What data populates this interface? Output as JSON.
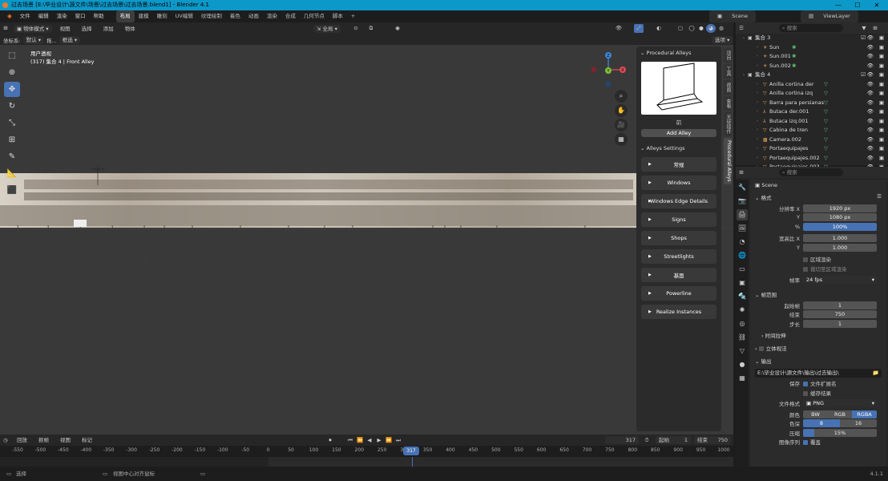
{
  "window": {
    "title": "过去场景 [E:\\毕业设计\\源文件\\场景\\过去场景\\过去场景.blend1] - Blender 4.1",
    "minimize": "—",
    "maximize": "☐",
    "close": "✕"
  },
  "menu": {
    "items": [
      "文件",
      "编辑",
      "渲染",
      "窗口",
      "帮助"
    ],
    "workspaces": [
      "布局",
      "建模",
      "雕刻",
      "UV编辑",
      "纹理绘制",
      "着色",
      "动画",
      "渲染",
      "合成",
      "几何节点",
      "脚本"
    ],
    "active_workspace": "布局",
    "add_tab": "+",
    "scene": "Scene",
    "view_layer": "ViewLayer"
  },
  "viewport_header": {
    "mode": "物体模式",
    "menus": [
      "视图",
      "选择",
      "添加",
      "物体"
    ],
    "transform_orientation": "全局",
    "options": "选项"
  },
  "viewport_header2": {
    "coord_label": "坐标系:",
    "coord_value": "默认",
    "drag_label": "拖...",
    "drag_value": "框选"
  },
  "viewport": {
    "view_name": "用户透视",
    "object_info": "(317) 集合 4 | Front Alley",
    "gizmo_axes": {
      "x": "X",
      "y": "Y",
      "z": "Z"
    },
    "accent_x": "#e04a55",
    "accent_y": "#7fbf3a",
    "accent_z": "#3f86d8"
  },
  "npanel": {
    "header": "Procedural Alleys",
    "thumb_label": "前",
    "add_button": "Add Alley",
    "settings_header": "Alleys Settings",
    "buttons": [
      "常规",
      "Windows",
      "Windows Edge Details",
      "Signs",
      "Shops",
      "Streetlights",
      "基面",
      "Powerline",
      "Realize Instances"
    ],
    "tabs": [
      "项目",
      "工具",
      "视图",
      "查看",
      "天使插件",
      "Procedural Alleys"
    ]
  },
  "outliner": {
    "search_placeholder": "搜索",
    "rows": [
      {
        "name": "集合 3",
        "indent": 1,
        "icon": "collection"
      },
      {
        "name": "Sun",
        "indent": 2,
        "icon": "light"
      },
      {
        "name": "Sun.001",
        "indent": 2,
        "icon": "light"
      },
      {
        "name": "Sun.002",
        "indent": 2,
        "icon": "light"
      },
      {
        "name": "集合 4",
        "indent": 1,
        "icon": "collection"
      },
      {
        "name": "Anilla cortina der",
        "indent": 2,
        "icon": "mesh"
      },
      {
        "name": "Anilla cortina izq",
        "indent": 2,
        "icon": "mesh"
      },
      {
        "name": "Barra para persianas",
        "indent": 2,
        "icon": "mesh"
      },
      {
        "name": "Butaca der.001",
        "indent": 2,
        "icon": "armature"
      },
      {
        "name": "Butaca izq.001",
        "indent": 2,
        "icon": "armature"
      },
      {
        "name": "Cabina de tren",
        "indent": 2,
        "icon": "mesh"
      },
      {
        "name": "Camera.002",
        "indent": 2,
        "icon": "camera"
      },
      {
        "name": "Portaequipajes",
        "indent": 2,
        "icon": "mesh"
      },
      {
        "name": "Portaequipajes.002",
        "indent": 2,
        "icon": "mesh"
      },
      {
        "name": "Portaequipajes.003",
        "indent": 2,
        "icon": "mesh"
      }
    ]
  },
  "properties": {
    "search_placeholder": "搜索",
    "scene_label": "Scene",
    "format_header": "格式",
    "res_x_label": "分辨率 X",
    "res_x": "1920 px",
    "res_y_label": "Y",
    "res_y": "1080 px",
    "res_pct_label": "%",
    "res_pct": "100%",
    "aspect_x_label": "宽高比 X",
    "aspect_x": "1.000",
    "aspect_y_label": "Y",
    "aspect_y": "1.000",
    "region_label": "区域渲染",
    "crop_label": "裁切至区域渲染",
    "fps_label": "帧率",
    "fps": "24 fps",
    "frame_range_header": "帧范围",
    "start_label": "起始帧",
    "start": "1",
    "end_label": "结束",
    "end": "750",
    "step_label": "步长",
    "step": "1",
    "time_stretch": "时间拉伸",
    "stereo": "立体视法",
    "output_header": "输出",
    "output_path": "E:\\毕业设计\\源文件\\输出\\过去输出\\",
    "save_label": "保存",
    "file_ext_label": "文件扩展名",
    "cache_label": "缓存结果",
    "file_format_label": "文件格式",
    "file_format": "PNG",
    "color_label": "颜色",
    "color_opts": [
      "BW",
      "RGB",
      "RGBA"
    ],
    "color_active": "RGBA",
    "depth_label": "色深",
    "depth_opts": [
      "8",
      "16"
    ],
    "compress_label": "压缩",
    "compress": "15%",
    "seq_label": "图像序列",
    "overwrite_label": "覆盖"
  },
  "timeline": {
    "menus": [
      "回放",
      "抠帧",
      "视图",
      "标记"
    ],
    "current_frame": "317",
    "start_label": "起始",
    "start": "1",
    "end_label": "结束",
    "end": "750",
    "ticks": [
      "-550",
      "-500",
      "-450",
      "-400",
      "-350",
      "-300",
      "-250",
      "-200",
      "-150",
      "-100",
      "-50",
      "0",
      "50",
      "100",
      "150",
      "200",
      "250",
      "300",
      "350",
      "400",
      "450",
      "500",
      "550",
      "600",
      "650",
      "700",
      "750",
      "800",
      "850",
      "900",
      "950",
      "1000"
    ],
    "playhead": "317"
  },
  "statusbar": {
    "select": "选择",
    "center": "视图中心对齐鼠标",
    "version": "4.1.1"
  }
}
